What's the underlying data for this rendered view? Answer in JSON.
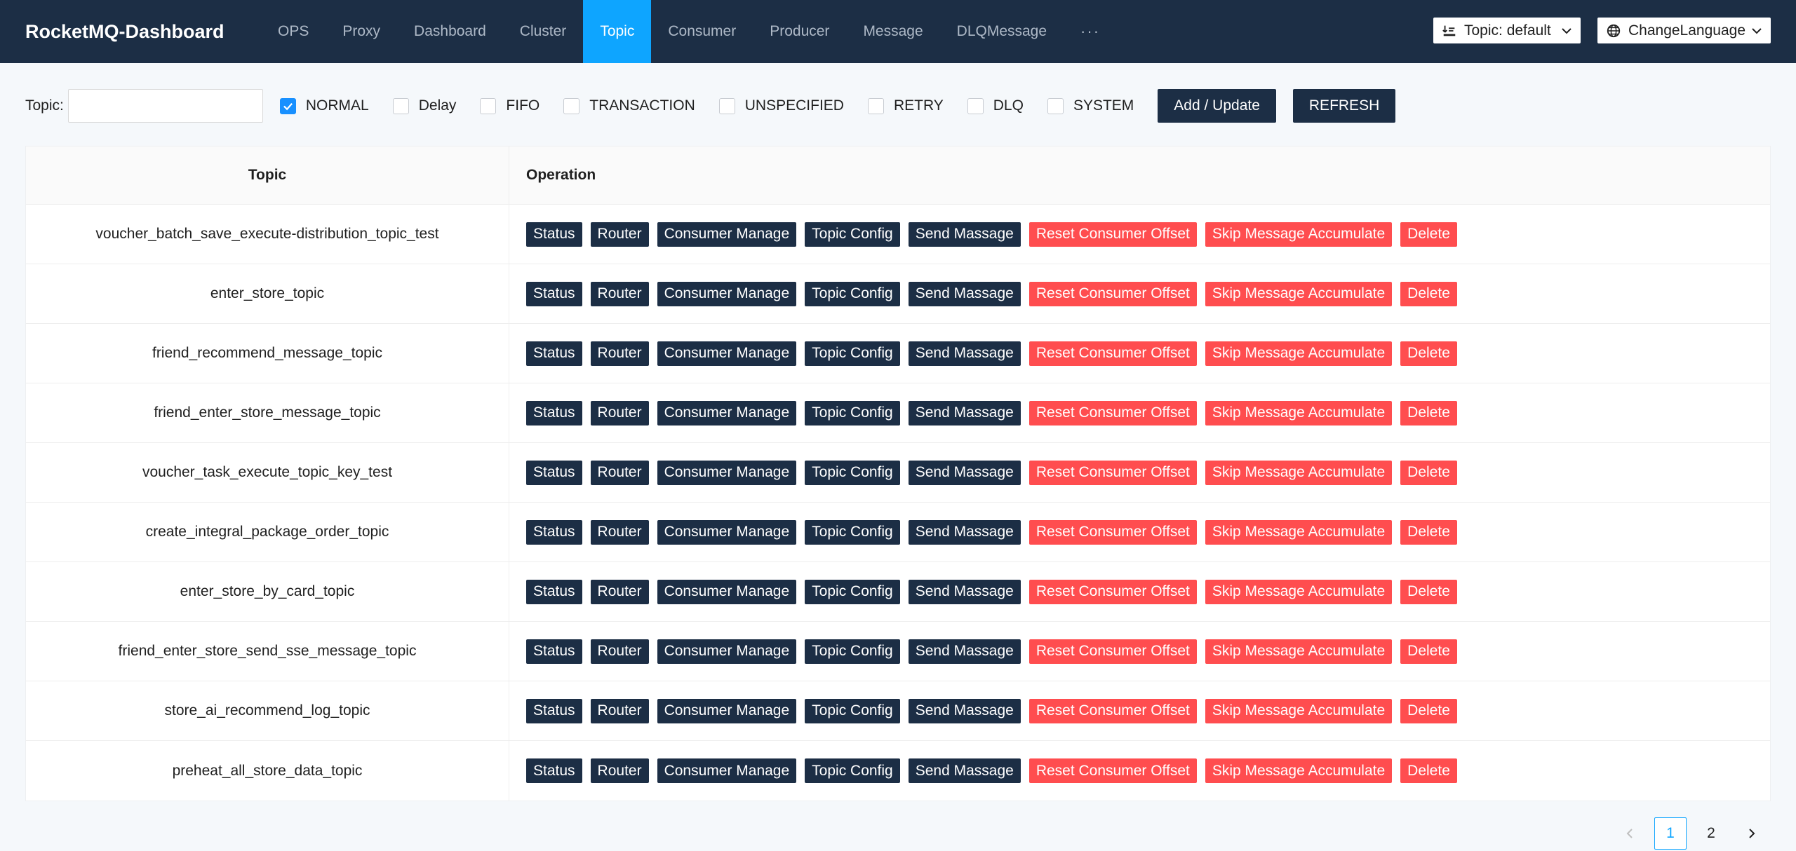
{
  "app": {
    "brand": "RocketMQ-Dashboard"
  },
  "nav": {
    "items": [
      "OPS",
      "Proxy",
      "Dashboard",
      "Cluster",
      "Topic",
      "Consumer",
      "Producer",
      "Message",
      "DLQMessage"
    ],
    "active": "Topic",
    "more": "···"
  },
  "header": {
    "topic_select": "Topic: default",
    "language_select": "ChangeLanguage"
  },
  "filters": {
    "topic_label": "Topic:",
    "topic_value": "",
    "types": [
      {
        "label": "NORMAL",
        "checked": true
      },
      {
        "label": "Delay",
        "checked": false
      },
      {
        "label": "FIFO",
        "checked": false
      },
      {
        "label": "TRANSACTION",
        "checked": false
      },
      {
        "label": "UNSPECIFIED",
        "checked": false
      },
      {
        "label": "RETRY",
        "checked": false
      },
      {
        "label": "DLQ",
        "checked": false
      },
      {
        "label": "SYSTEM",
        "checked": false
      }
    ],
    "add_update_label": "Add / Update",
    "refresh_label": "REFRESH"
  },
  "table": {
    "headers": {
      "topic": "Topic",
      "operation": "Operation"
    },
    "operations": [
      {
        "label": "Status",
        "style": "dark"
      },
      {
        "label": "Router",
        "style": "dark"
      },
      {
        "label": "Consumer Manage",
        "style": "dark"
      },
      {
        "label": "Topic Config",
        "style": "dark"
      },
      {
        "label": "Send Massage",
        "style": "dark"
      },
      {
        "label": "Reset Consumer Offset",
        "style": "red"
      },
      {
        "label": "Skip Message Accumulate",
        "style": "red"
      },
      {
        "label": "Delete",
        "style": "red"
      }
    ],
    "rows": [
      "voucher_batch_save_execute-distribution_topic_test",
      "enter_store_topic",
      "friend_recommend_message_topic",
      "friend_enter_store_message_topic",
      "voucher_task_execute_topic_key_test",
      "create_integral_package_order_topic",
      "enter_store_by_card_topic",
      "friend_enter_store_send_sse_message_topic",
      "store_ai_recommend_log_topic",
      "preheat_all_store_data_topic"
    ]
  },
  "pagination": {
    "pages": [
      "1",
      "2"
    ],
    "current": "1"
  },
  "colors": {
    "header_bg": "#1c2e45",
    "accent": "#0ea5ff",
    "danger": "#ff4d4f",
    "checkbox": "#1890ff"
  }
}
